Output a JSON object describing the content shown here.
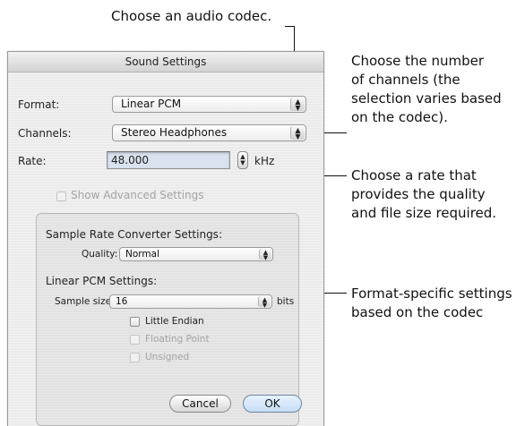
{
  "callouts": {
    "codec": "Choose an audio codec.",
    "channels": [
      "Choose the number",
      "of channels (the",
      "selection varies based",
      "on the codec)."
    ],
    "rate": [
      "Choose a rate that",
      "provides the quality",
      "and file size required."
    ],
    "format_specific": [
      "Format-specific settings",
      "based on the codec"
    ]
  },
  "dialog": {
    "title": "Sound Settings",
    "format_label": "Format:",
    "format_value": "Linear PCM",
    "channels_label": "Channels:",
    "channels_value": "Stereo Headphones",
    "rate_label": "Rate:",
    "rate_value": "48.000",
    "rate_unit": "kHz",
    "show_advanced": "Show Advanced Settings",
    "src_heading": "Sample Rate Converter Settings:",
    "quality_label": "Quality:",
    "quality_value": "Normal",
    "pcm_heading": "Linear PCM Settings:",
    "sample_size_label": "Sample size:",
    "sample_size_value": "16",
    "sample_size_unit": "bits",
    "little_endian": "Little Endian",
    "floating_point": "Floating Point",
    "unsigned": "Unsigned",
    "cancel": "Cancel",
    "ok": "OK"
  },
  "icons": {
    "popup_arrows": "updown-arrows-icon",
    "stepper": "stepper-icon"
  }
}
